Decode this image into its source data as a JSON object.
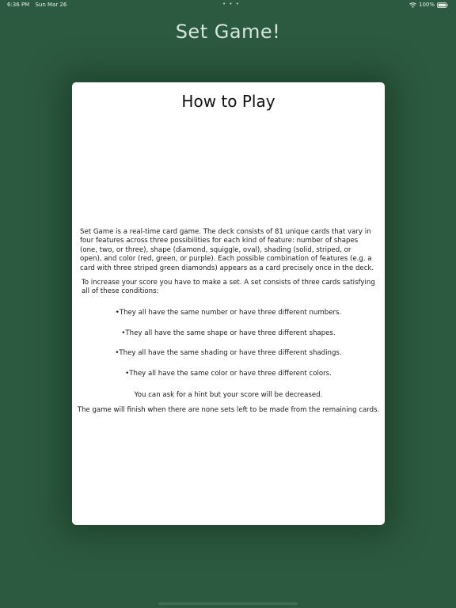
{
  "status_bar": {
    "time": "6:36 PM",
    "date": "Sun Mar 26",
    "dots": "• • •",
    "battery_percent": "100%"
  },
  "app": {
    "title": "Set Game!"
  },
  "how_to_play": {
    "title": "How to Play",
    "intro": "Set Game is a real-time card game. The deck consists of 81 unique cards that vary in four features across three possibilities for each kind of feature: number of shapes (one, two, or three), shape (diamond, squiggle, oval), shading (solid, striped, or open), and color (red, green, or purple). Each possible combination of features (e.g. a card with three striped green diamonds) appears as a card precisely once in the deck.",
    "condition_lead": "To increase your score you have to make a set. A set consists of three cards satisfying all of these conditions:",
    "rules": [
      "•They all have the same number or have three different numbers.",
      "•They all have the same shape or have three different shapes.",
      "•They all have the same shading or have three different shadings.",
      "•They all have the same color or have three different colors."
    ],
    "hint": "You can ask for a hint but your score will be decreased.",
    "finish": "The game will finish when there are none sets left to be made from the remaining cards."
  },
  "colors": {
    "background": "#2c5a40",
    "card": "#ffffff",
    "title": "#d4e6d9"
  }
}
